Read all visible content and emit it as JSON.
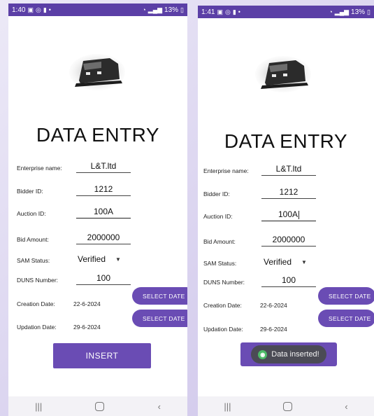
{
  "left": {
    "status": {
      "time": "1:40",
      "battery": "13%"
    },
    "title": "DATA ENTRY",
    "fields": {
      "enterprise": {
        "label": "Enterprise name:",
        "value": "L&T.ltd"
      },
      "bidder": {
        "label": "Bidder ID:",
        "value": "1212"
      },
      "auction": {
        "label": "Auction ID:",
        "value": "100A"
      },
      "bid": {
        "label": "Bid Amount:",
        "value": "2000000"
      },
      "sam": {
        "label": "SAM Status:",
        "value": "Verified"
      },
      "duns": {
        "label": "DUNS Number:",
        "value": "100"
      },
      "creation": {
        "label": "Creation Date:",
        "value": "22-6-2024",
        "button": "SELECT DATE"
      },
      "updation": {
        "label": "Updation Date:",
        "value": "29-6-2024",
        "button": "SELECT DATE"
      }
    },
    "insert_label": "INSERT"
  },
  "right": {
    "status": {
      "time": "1:41",
      "battery": "13%"
    },
    "title": "DATA ENTRY",
    "fields": {
      "enterprise": {
        "label": "Enterprise name:",
        "value": "L&T.ltd"
      },
      "bidder": {
        "label": "Bidder ID:",
        "value": "1212"
      },
      "auction": {
        "label": "Auction ID:",
        "value": "100A"
      },
      "bid": {
        "label": "Bid Amount:",
        "value": "2000000"
      },
      "sam": {
        "label": "SAM Status:",
        "value": "Verified"
      },
      "duns": {
        "label": "DUNS Number:",
        "value": "100"
      },
      "creation": {
        "label": "Creation Date:",
        "value": "22-6-2024",
        "button": "SELECT DATE"
      },
      "updation": {
        "label": "Updation Date:",
        "value": "29-6-2024",
        "button": "SELECT DATE"
      }
    },
    "toast": "Data inserted!"
  },
  "colors": {
    "accent": "#6a4cb4",
    "status_bar": "#5b3fa6",
    "toast_bg": "#4b4b55",
    "toast_icon": "#4dbb68"
  },
  "icons": [
    "image-icon",
    "whatsapp-icon",
    "lock-icon",
    "wifi-icon",
    "signal-icon",
    "battery-icon",
    "train-logo-icon",
    "dropdown-caret-icon",
    "recents-icon",
    "home-icon",
    "back-icon"
  ]
}
